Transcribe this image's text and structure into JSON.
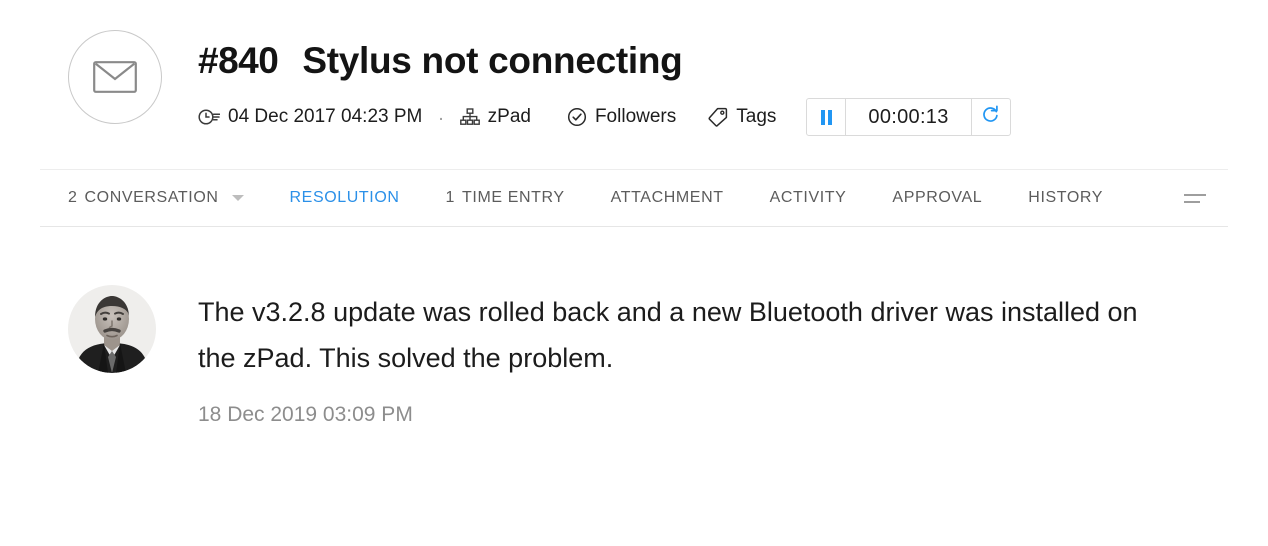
{
  "ticket": {
    "icon": "envelope-icon",
    "id": "#840",
    "title": "Stylus not connecting",
    "created_at": "04 Dec 2017 04:23 PM",
    "separator": ".",
    "asset": "zPad",
    "followers_label": "Followers",
    "tags_label": "Tags"
  },
  "timer": {
    "pause_icon": "pause-icon",
    "value": "00:00:13",
    "reset_icon": "refresh-icon",
    "accent_color": "#2196f3"
  },
  "tabs": {
    "active_color": "#2b90e8",
    "menu_icon": "hamburger-menu-icon",
    "items": [
      {
        "count": "2",
        "label": "CONVERSATION",
        "active": false,
        "caret": true
      },
      {
        "count": "",
        "label": "RESOLUTION",
        "active": true,
        "caret": false
      },
      {
        "count": "1",
        "label": "TIME ENTRY",
        "active": false,
        "caret": false
      },
      {
        "count": "",
        "label": "ATTACHMENT",
        "active": false,
        "caret": false
      },
      {
        "count": "",
        "label": "ACTIVITY",
        "active": false,
        "caret": false
      },
      {
        "count": "",
        "label": "APPROVAL",
        "active": false,
        "caret": false
      },
      {
        "count": "",
        "label": "HISTORY",
        "active": false,
        "caret": false
      }
    ]
  },
  "resolution": {
    "avatar": "user-photo-avatar",
    "text": "The v3.2.8 update was rolled back and a new Bluetooth driver was installed on the zPad. This solved the problem.",
    "timestamp": "18 Dec 2019 03:09 PM"
  }
}
